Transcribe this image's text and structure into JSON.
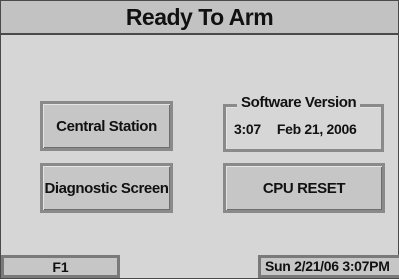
{
  "header": {
    "title": "Ready To Arm"
  },
  "buttons": {
    "central_station": "Central Station",
    "diagnostic_screen": "Diagnostic Screen",
    "cpu_reset": "CPU RESET",
    "f1": "F1"
  },
  "software_version": {
    "label": "Software Version",
    "time": "3:07",
    "date": "Feb 21, 2006"
  },
  "status_bar": {
    "clock": "Sun 2/21/06 3:07PM"
  }
}
